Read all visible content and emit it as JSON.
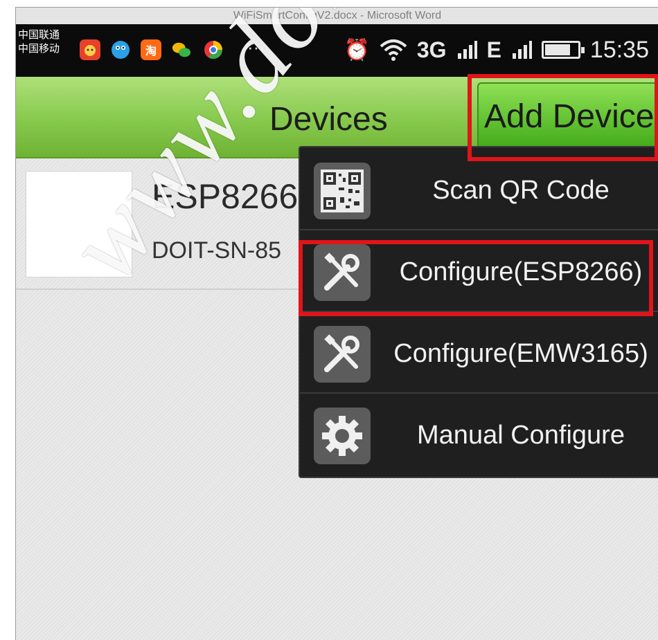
{
  "window": {
    "caption": "WiFiSmartConfigV2.docx - Microsoft Word"
  },
  "statusbar": {
    "carrier_1": "中国联通",
    "carrier_2": "中国移动",
    "app_icons": [
      "cat-app-icon",
      "bird-app-icon",
      "taobao-app-icon",
      "wechat-app-icon",
      "browser-app-icon"
    ],
    "taobao_glyph": "淘",
    "more": "···",
    "alarm": "⏰",
    "network_3g": "3G",
    "network_e": "E",
    "time": "15:35"
  },
  "actionbar": {
    "title": "Devices",
    "add_device_label": "Add Device"
  },
  "device": {
    "name": "ESP8266",
    "id": "DOIT-SN-85"
  },
  "menu": {
    "items": [
      {
        "label": "Scan QR Code",
        "icon": "qr-code-icon"
      },
      {
        "label": "Configure(ESP8266)",
        "icon": "tools-icon"
      },
      {
        "label": "Configure(EMW3165)",
        "icon": "tools-icon"
      },
      {
        "label": "Manual Configure",
        "icon": "gear-icon"
      }
    ]
  },
  "watermark": "www.doit.am",
  "colors": {
    "action_bar": "#86c94c",
    "add_button": "#3fa918",
    "menu_bg": "#1f1f1f",
    "highlight": "#e0141a"
  }
}
